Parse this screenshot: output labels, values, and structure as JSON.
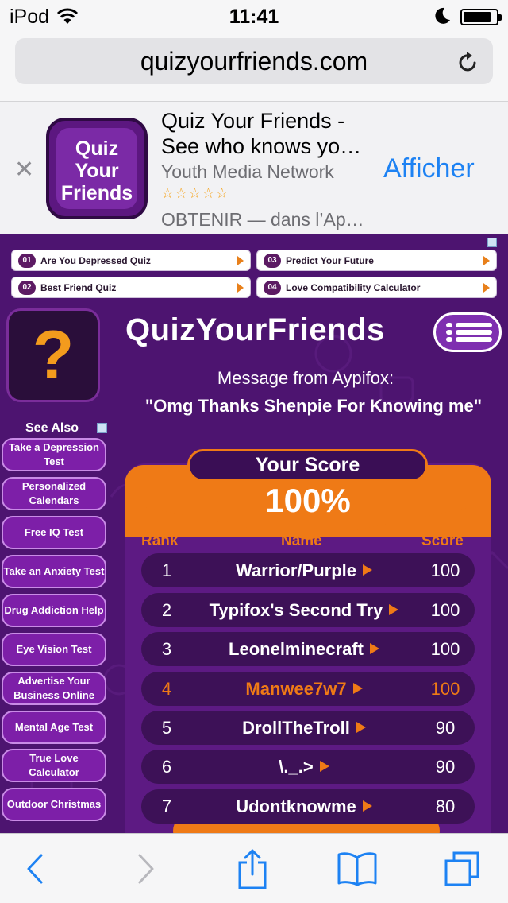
{
  "status_bar": {
    "carrier": "iPod",
    "time": "11:41"
  },
  "url_bar": {
    "url": "quizyourfriends.com"
  },
  "app_banner": {
    "icon_text": "Quiz Your Friends",
    "title": "Quiz Your Friends - See who knows yo…",
    "publisher": "Youth Media Network",
    "rating_stars": "☆☆☆☆☆",
    "rating_value": 0,
    "get_text": "OBTENIR — dans l’Ap…",
    "view_label": "Afficher"
  },
  "ads": [
    {
      "num": "01",
      "label": "Are You Depressed Quiz"
    },
    {
      "num": "03",
      "label": "Predict Your Future"
    },
    {
      "num": "02",
      "label": "Best Friend Quiz"
    },
    {
      "num": "04",
      "label": "Love Compatibility Calculator"
    }
  ],
  "site": {
    "brand": "QuizYourFriends",
    "message_from": "Message from Aypifox:",
    "message": "\"Omg Thanks Shenpie For Knowing me\"",
    "see_also": "See Also",
    "sidebar_links": [
      "Take a Depression Test",
      "Personalized Calendars",
      "Free IQ Test",
      "Take an Anxiety Test",
      "Drug Addiction Help",
      "Eye Vision Test",
      "Advertise Your Business Online",
      "Mental Age Test",
      "True Love Calculator",
      "Outdoor Christmas"
    ]
  },
  "score": {
    "label": "Your Score",
    "value": "100%",
    "headers": {
      "rank": "Rank",
      "name": "Name",
      "score": "Score"
    },
    "rows": [
      {
        "rank": "1",
        "name": "Warrior/Purple",
        "score": "100"
      },
      {
        "rank": "2",
        "name": "Typifox's Second Try",
        "score": "100"
      },
      {
        "rank": "3",
        "name": "Leonelminecraft",
        "score": "100"
      },
      {
        "rank": "4",
        "name": "Manwee7w7",
        "score": "100",
        "highlight": true
      },
      {
        "rank": "5",
        "name": "DrollTheTroll",
        "score": "90"
      },
      {
        "rank": "6",
        "name": "\\._.>",
        "score": "90"
      },
      {
        "rank": "7",
        "name": "Udontknowme",
        "score": "80"
      }
    ]
  },
  "colors": {
    "site_bg": "#4d1470",
    "accent_orange": "#ef7a16",
    "ios_blue": "#1d82f3"
  },
  "icons": [
    "wifi-icon",
    "moon-icon",
    "battery-icon",
    "reload-icon",
    "close-icon",
    "menu-icon",
    "back-icon",
    "forward-icon",
    "share-icon",
    "bookmarks-icon",
    "tabs-icon"
  ]
}
